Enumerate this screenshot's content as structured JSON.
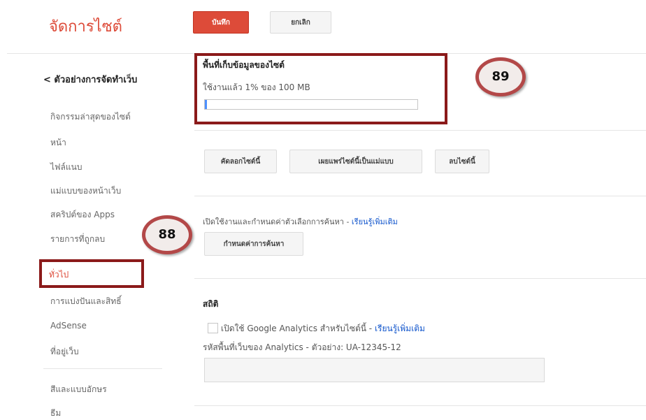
{
  "page_title": "จัดการไซต์",
  "toolbar": {
    "save_label": "บันทึก",
    "cancel_label": "ยกเลิก"
  },
  "sidebar": {
    "back_label": "< ตัวอย่างการจัดทำเว็บ",
    "items": [
      "กิจกรรมล่าสุดของไซต์",
      "หน้า",
      "ไฟล์แนบ",
      "แม่แบบของหน้าเว็บ",
      "สคริปต์ของ Apps",
      "รายการที่ถูกลบ",
      "ทั่วไป",
      "การแบ่งปันและสิทธิ์",
      "AdSense",
      "ที่อยู่เว็บ",
      "สีและแบบอักษร",
      "ธีม"
    ]
  },
  "storage": {
    "title": "พื้นที่เก็บข้อมูลของไซต์",
    "usage_text": "ใช้งานแล้ว 1% ของ 100 MB",
    "usage_fraction": 0.01
  },
  "site_actions": [
    "คัดลอกไซต์นี้",
    "เผยแพร่ไซต์นี้เป็นแม่แบบ",
    "ลบไซต์นี้"
  ],
  "search": {
    "text": "เปิดใช้งานและกำหนดค่าตัวเลือกการค้นหา - ",
    "learn_more": "เรียนรู้เพิ่มเติม",
    "button": "กำหนดค่าการค้นหา"
  },
  "stats": {
    "title": "สถิติ",
    "checkbox_label": "เปิดใช้ Google Analytics สำหรับไซต์นี้ - ",
    "learn_more": "เรียนรู้เพิ่มเติม",
    "property_label": "รหัสพื้นที่เว็บของ Analytics - ตัวอย่าง: UA-12345-12",
    "property_value": ""
  },
  "callouts": {
    "sidebar_marker": "88",
    "storage_marker": "89"
  },
  "colors": {
    "accent": "#dd4b39",
    "callout_border": "#8b1a1a",
    "link": "#1155cc"
  }
}
